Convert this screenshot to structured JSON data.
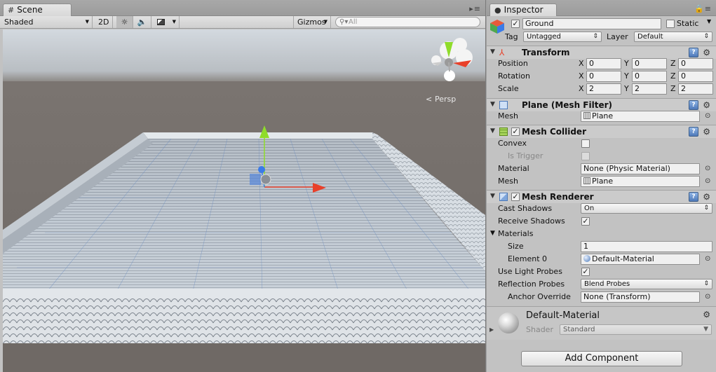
{
  "scene": {
    "tab_label": "Scene",
    "tab_icon": "grid-icon",
    "toolbar": {
      "draw_mode": "Shaded",
      "mode_2d": "2D",
      "gizmos": "Gizmos"
    },
    "search_placeholder": "All",
    "persp_label": "Persp"
  },
  "inspector": {
    "tab_label": "Inspector",
    "object": {
      "name": "Ground",
      "active": true,
      "static_label": "Static",
      "static_checked": false,
      "tag_label": "Tag",
      "tag_value": "Untagged",
      "layer_label": "Layer",
      "layer_value": "Default"
    },
    "transform": {
      "title": "Transform",
      "position_label": "Position",
      "rotation_label": "Rotation",
      "scale_label": "Scale",
      "axis_x": "X",
      "axis_y": "Y",
      "axis_z": "Z",
      "position": {
        "x": "0",
        "y": "0",
        "z": "0"
      },
      "rotation": {
        "x": "0",
        "y": "0",
        "z": "0"
      },
      "scale": {
        "x": "2",
        "y": "2",
        "z": "2"
      }
    },
    "mesh_filter": {
      "title": "Plane (Mesh Filter)",
      "mesh_label": "Mesh",
      "mesh_value": "Plane"
    },
    "mesh_collider": {
      "title": "Mesh Collider",
      "enabled": true,
      "convex_label": "Convex",
      "is_trigger_label": "Is Trigger",
      "material_label": "Material",
      "material_value": "None (Physic Material)",
      "mesh_label": "Mesh",
      "mesh_value": "Plane"
    },
    "mesh_renderer": {
      "title": "Mesh Renderer",
      "enabled": true,
      "cast_shadows_label": "Cast Shadows",
      "cast_shadows_value": "On",
      "receive_shadows_label": "Receive Shadows",
      "receive_shadows": true,
      "materials_label": "Materials",
      "size_label": "Size",
      "size_value": "1",
      "element0_label": "Element 0",
      "element0_value": "Default-Material",
      "use_light_probes_label": "Use Light Probes",
      "use_light_probes": true,
      "reflection_probes_label": "Reflection Probes",
      "reflection_probes_value": "Blend Probes",
      "anchor_override_label": "Anchor Override",
      "anchor_override_value": "None (Transform)"
    },
    "material": {
      "name": "Default-Material",
      "shader_label": "Shader",
      "shader_value": "Standard"
    },
    "add_component_label": "Add Component"
  },
  "colors": {
    "panel_bg": "#c2c2c2",
    "sky": "#c9ced4",
    "ground_far": "#7b7571",
    "gizmo_y": "#8fdc2a",
    "gizmo_x": "#e8402a",
    "gizmo_z": "#3a7be8"
  }
}
